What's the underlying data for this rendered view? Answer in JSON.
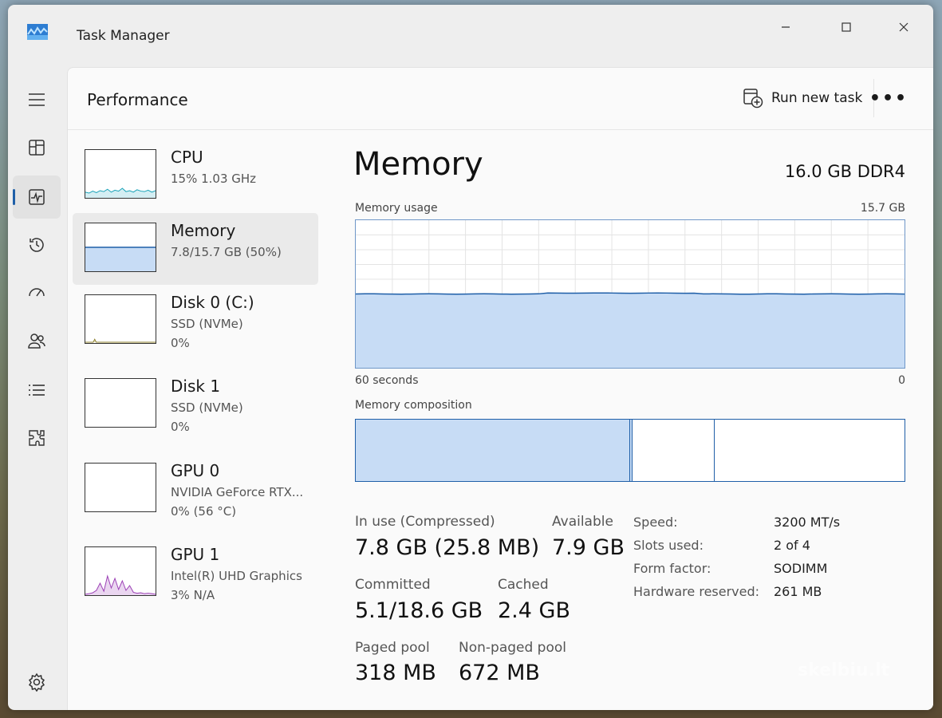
{
  "window": {
    "title": "Task Manager"
  },
  "header": {
    "title": "Performance",
    "run_task_label": "Run new task",
    "more_label": "•••"
  },
  "devices": [
    {
      "name": "CPU",
      "line1": "15%  1.03 GHz",
      "line2": ""
    },
    {
      "name": "Memory",
      "line1": "7.8/15.7 GB (50%)",
      "line2": ""
    },
    {
      "name": "Disk 0 (C:)",
      "line1": "SSD (NVMe)",
      "line2": "0%"
    },
    {
      "name": "Disk 1",
      "line1": "SSD (NVMe)",
      "line2": "0%"
    },
    {
      "name": "GPU 0",
      "line1": "NVIDIA GeForce RTX...",
      "line2": "0%  (56 °C)"
    },
    {
      "name": "GPU 1",
      "line1": "Intel(R) UHD Graphics",
      "line2": "3%  N/A"
    }
  ],
  "main": {
    "title": "Memory",
    "spec": "16.0 GB DDR4",
    "usage_label": "Memory usage",
    "usage_max": "15.7 GB",
    "time_left": "60 seconds",
    "time_right": "0",
    "composition_label": "Memory composition",
    "usage_level": 0.5,
    "composition": [
      {
        "name": "in-use",
        "fraction": 0.5,
        "color": "#c7dcf5"
      },
      {
        "name": "modified",
        "fraction": 0.004,
        "color": "#c7dcf5"
      },
      {
        "name": "standby",
        "fraction": 0.15,
        "color": "#ffffff"
      },
      {
        "name": "free",
        "fraction": 0.346,
        "color": "#ffffff"
      }
    ]
  },
  "stats": {
    "in_use_label": "In use (Compressed)",
    "in_use_value": "7.8 GB (25.8 MB)",
    "available_label": "Available",
    "available_value": "7.9 GB",
    "committed_label": "Committed",
    "committed_value": "5.1/18.6 GB",
    "cached_label": "Cached",
    "cached_value": "2.4 GB",
    "paged_label": "Paged pool",
    "paged_value": "318 MB",
    "nonpaged_label": "Non-paged pool",
    "nonpaged_value": "672 MB"
  },
  "details": [
    {
      "key": "Speed:",
      "value": "3200 MT/s"
    },
    {
      "key": "Slots used:",
      "value": "2 of 4"
    },
    {
      "key": "Form factor:",
      "value": "SODIMM"
    },
    {
      "key": "Hardware reserved:",
      "value": "261 MB"
    }
  ],
  "watermark": "skelbiu.lt",
  "colors": {
    "accent": "#1f5fa8",
    "memory_fill": "#c7dcf5",
    "cpu_line": "#17a2b8",
    "gpu1_line": "#9b3fb5"
  }
}
